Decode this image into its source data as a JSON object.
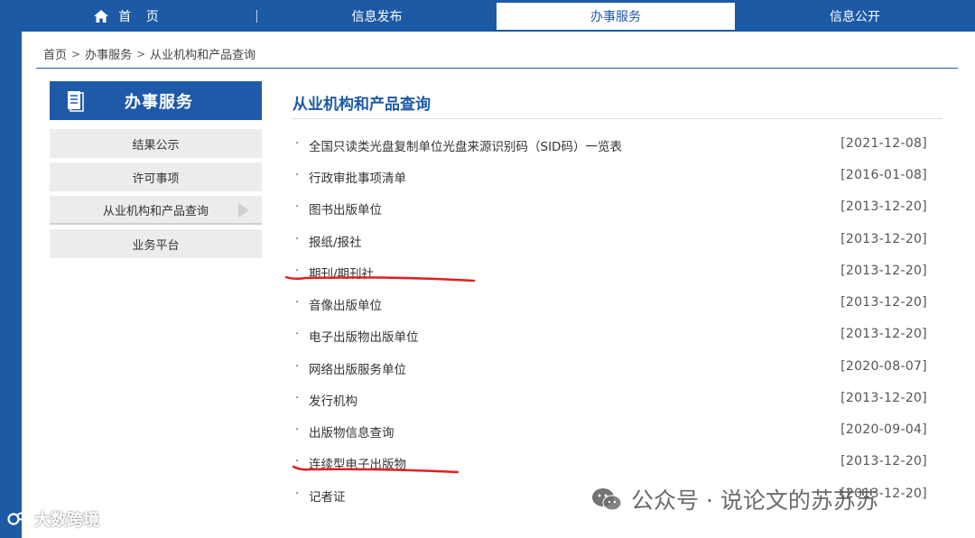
{
  "nav": {
    "home": "首 页",
    "items": [
      "信息发布",
      "办事服务",
      "信息公开"
    ],
    "active_index": 1
  },
  "breadcrumb": {
    "items": [
      "首页",
      "办事服务",
      "从业机构和产品查询"
    ],
    "separator": ">"
  },
  "sidebar": {
    "title": "办事服务",
    "items": [
      {
        "label": "结果公示"
      },
      {
        "label": "许可事项"
      },
      {
        "label": "从业机构和产品查询"
      },
      {
        "label": "业务平台"
      }
    ],
    "current_index": 2
  },
  "main": {
    "title": "从业机构和产品查询",
    "bullet": "·",
    "items": [
      {
        "title": "全国只读类光盘复制单位光盘来源识别码（SID码）一览表",
        "date": "[2021-12-08]"
      },
      {
        "title": "行政审批事项清单",
        "date": "[2016-01-08]"
      },
      {
        "title": "图书出版单位",
        "date": "[2013-12-20]"
      },
      {
        "title": "报纸/报社",
        "date": "[2013-12-20]"
      },
      {
        "title": "期刊/期刊社",
        "date": "[2013-12-20]"
      },
      {
        "title": "音像出版单位",
        "date": "[2013-12-20]"
      },
      {
        "title": "电子出版物出版单位",
        "date": "[2013-12-20]"
      },
      {
        "title": "网络出版服务单位",
        "date": "[2020-08-07]"
      },
      {
        "title": "发行机构",
        "date": "[2013-12-20]"
      },
      {
        "title": "出版物信息查询",
        "date": "[2020-09-04]"
      },
      {
        "title": "连续型电子出版物",
        "date": "[2013-12-20]"
      },
      {
        "title": "记者证",
        "date": "[2013-12-20]"
      }
    ]
  },
  "watermarks": {
    "left": "大数跨境",
    "right": "公众号 · 说论文的苏苏苏"
  },
  "colors": {
    "brand_blue": "#1c5aa6",
    "annotation_red": "#e02020"
  }
}
